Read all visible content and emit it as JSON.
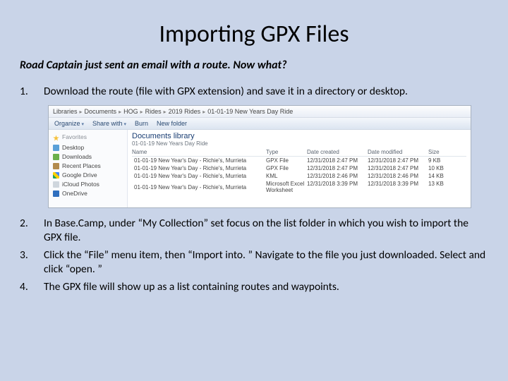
{
  "title": "Importing GPX Files",
  "lead": "Road Captain just sent an email with a route.  Now what?",
  "steps": {
    "s1": {
      "num": "1.",
      "text": "Download the route (file with GPX extension) and save it in a directory or desktop."
    },
    "s2": {
      "num": "2.",
      "text": "In Base.Camp, under “My Collection” set focus on the list folder in which you wish to import the GPX file."
    },
    "s3": {
      "num": "3.",
      "text": "Click the “File” menu item, then “Import into. ” Navigate to the file you just downloaded.  Select and click  “open. ”"
    },
    "s4": {
      "num": "4.",
      "text": "The GPX file will show up as a list containing routes and waypoints."
    }
  },
  "explorer": {
    "breadcrumb": [
      "Libraries",
      "Documents",
      "HOG",
      "Rides",
      "2019 Rides",
      "01-01-19 New Years Day Ride"
    ],
    "toolbar": {
      "organize": "Organize",
      "share": "Share with",
      "burn": "Burn",
      "newfolder": "New folder"
    },
    "sidebar": {
      "header": "Favorites",
      "items": {
        "desktop": "Desktop",
        "downloads": "Downloads",
        "recent": "Recent Places",
        "gdrive": "Google Drive",
        "icloud": "iCloud Photos",
        "onedrive": "OneDrive"
      }
    },
    "library": {
      "title": "Documents library",
      "subtitle": "01-01-19 New Years Day Ride"
    },
    "columns": {
      "name": "Name",
      "type": "Type",
      "created": "Date created",
      "modified": "Date modified",
      "size": "Size"
    },
    "files": {
      "f1": {
        "name": "01-01-19 New Year's Day - Richie's,  Murrieta",
        "type": "GPX File",
        "created": "12/31/2018 2:47 PM",
        "modified": "12/31/2018 2:47 PM",
        "size": "9 KB"
      },
      "f2": {
        "name": "01-01-19 New Year's Day - Richie's,  Murrieta",
        "type": "GPX File",
        "created": "12/31/2018 2:47 PM",
        "modified": "12/31/2018 2:47 PM",
        "size": "10 KB"
      },
      "f3": {
        "name": "01-01-19 New Year's Day - Richie's,  Murrieta",
        "type": "KML",
        "created": "12/31/2018 2:46 PM",
        "modified": "12/31/2018 2:46 PM",
        "size": "14 KB"
      },
      "f4": {
        "name": "01-01-19 New Year's Day - Richie's,  Murrieta",
        "type": "Microsoft Excel Worksheet",
        "created": "12/31/2018 3:39 PM",
        "modified": "12/31/2018 3:39 PM",
        "size": "13 KB"
      }
    }
  }
}
